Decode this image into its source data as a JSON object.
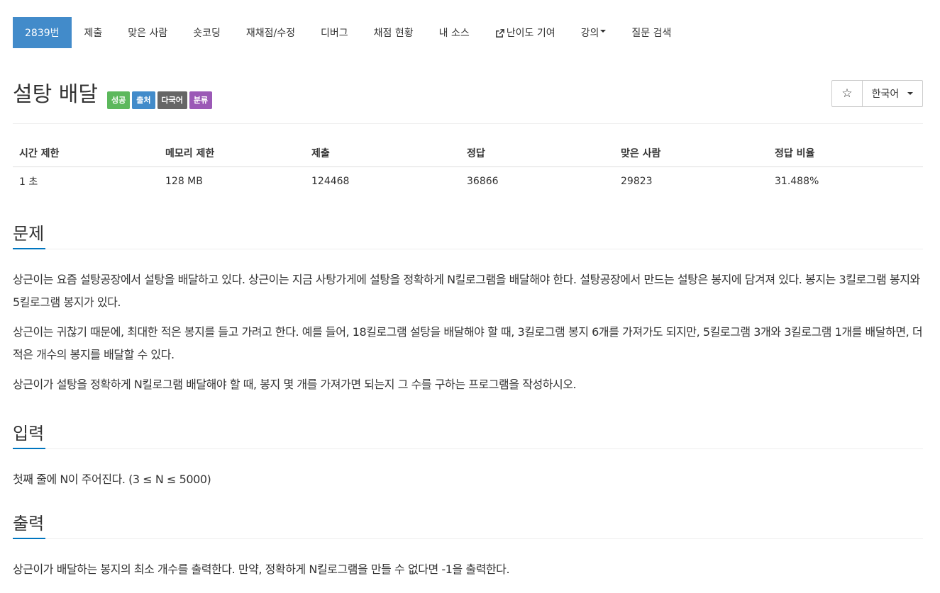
{
  "nav": {
    "items": [
      {
        "label": "2839번",
        "active": true
      },
      {
        "label": "제출"
      },
      {
        "label": "맞은 사람"
      },
      {
        "label": "숏코딩"
      },
      {
        "label": "재채점/수정"
      },
      {
        "label": "디버그"
      },
      {
        "label": "채점 현황"
      },
      {
        "label": "내 소스"
      },
      {
        "label": "난이도 기여",
        "icon": "external-link-icon"
      },
      {
        "label": "강의",
        "dropdown": true
      },
      {
        "label": "질문 검색"
      }
    ]
  },
  "problem": {
    "title": "설탕 배달",
    "labels": [
      {
        "text": "성공",
        "color": "#5cb85c"
      },
      {
        "text": "출처",
        "color": "#428bca"
      },
      {
        "text": "다국어",
        "color": "#666666"
      },
      {
        "text": "분류",
        "color": "#9b59b6"
      }
    ],
    "star_icon": "star-icon",
    "language": "한국어"
  },
  "stats": {
    "headers": [
      "시간 제한",
      "메모리 제한",
      "제출",
      "정답",
      "맞은 사람",
      "정답 비율"
    ],
    "values": [
      "1 초",
      "128 MB",
      "124468",
      "36866",
      "29823",
      "31.488%"
    ]
  },
  "sections": {
    "description": {
      "title": "문제",
      "paragraphs": [
        "상근이는 요즘 설탕공장에서 설탕을 배달하고 있다. 상근이는 지금 사탕가게에 설탕을 정확하게 N킬로그램을 배달해야 한다. 설탕공장에서 만드는 설탕은 봉지에 담겨져 있다. 봉지는 3킬로그램 봉지와 5킬로그램 봉지가 있다.",
        "상근이는 귀찮기 때문에, 최대한 적은 봉지를 들고 가려고 한다. 예를 들어, 18킬로그램 설탕을 배달해야 할 때, 3킬로그램 봉지 6개를 가져가도 되지만, 5킬로그램 3개와 3킬로그램 1개를 배달하면, 더 적은 개수의 봉지를 배달할 수 있다.",
        "상근이가 설탕을 정확하게 N킬로그램 배달해야 할 때, 봉지 몇 개를 가져가면 되는지 그 수를 구하는 프로그램을 작성하시오."
      ]
    },
    "input": {
      "title": "입력",
      "paragraphs": [
        "첫째 줄에 N이 주어진다. (3 ≤ N ≤ 5000)"
      ]
    },
    "output": {
      "title": "출력",
      "paragraphs": [
        "상근이가 배달하는 봉지의 최소 개수를 출력한다. 만약, 정확하게 N킬로그램을 만들 수 없다면 -1을 출력한다."
      ]
    }
  },
  "colors": {
    "accent": "#428bca",
    "section_underline": "#0076c0"
  }
}
